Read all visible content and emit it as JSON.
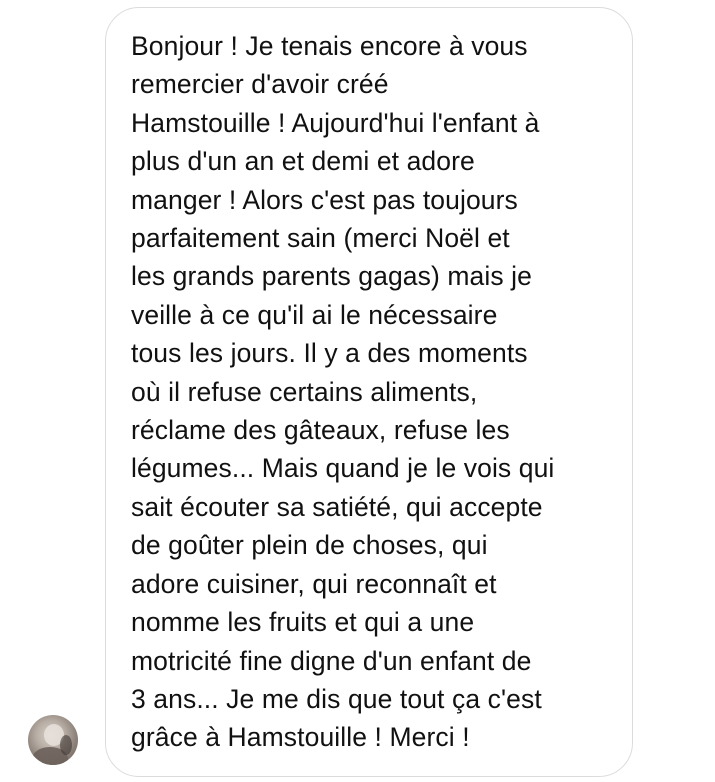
{
  "message": {
    "lines": [
      "Bonjour ! Je tenais encore à vous",
      "remercier d'avoir créé",
      "Hamstouille ! Aujourd'hui l'enfant à",
      "plus d'un an et demi et adore",
      "manger ! Alors c'est pas toujours",
      "parfaitement sain (merci Noël et",
      "les grands parents gagas) mais je",
      "veille à ce qu'il ai le nécessaire",
      "tous les jours. Il y a des moments",
      "où il refuse certains aliments,",
      "réclame des gâteaux, refuse les",
      "légumes... Mais quand je le vois qui",
      "sait écouter sa satiété, qui accepte",
      "de goûter plein de choses, qui",
      "adore cuisiner, qui reconnaît et",
      "nomme les fruits et qui a une",
      "motricité fine digne d'un enfant de",
      "3 ans... Je me dis que tout ça c'est",
      "grâce à Hamstouille ! Merci !"
    ]
  },
  "sender": {
    "avatar_icon": "profile-photo-icon"
  },
  "colors": {
    "bubble_border": "#dbdbdb",
    "text": "#111111",
    "background": "#ffffff"
  }
}
